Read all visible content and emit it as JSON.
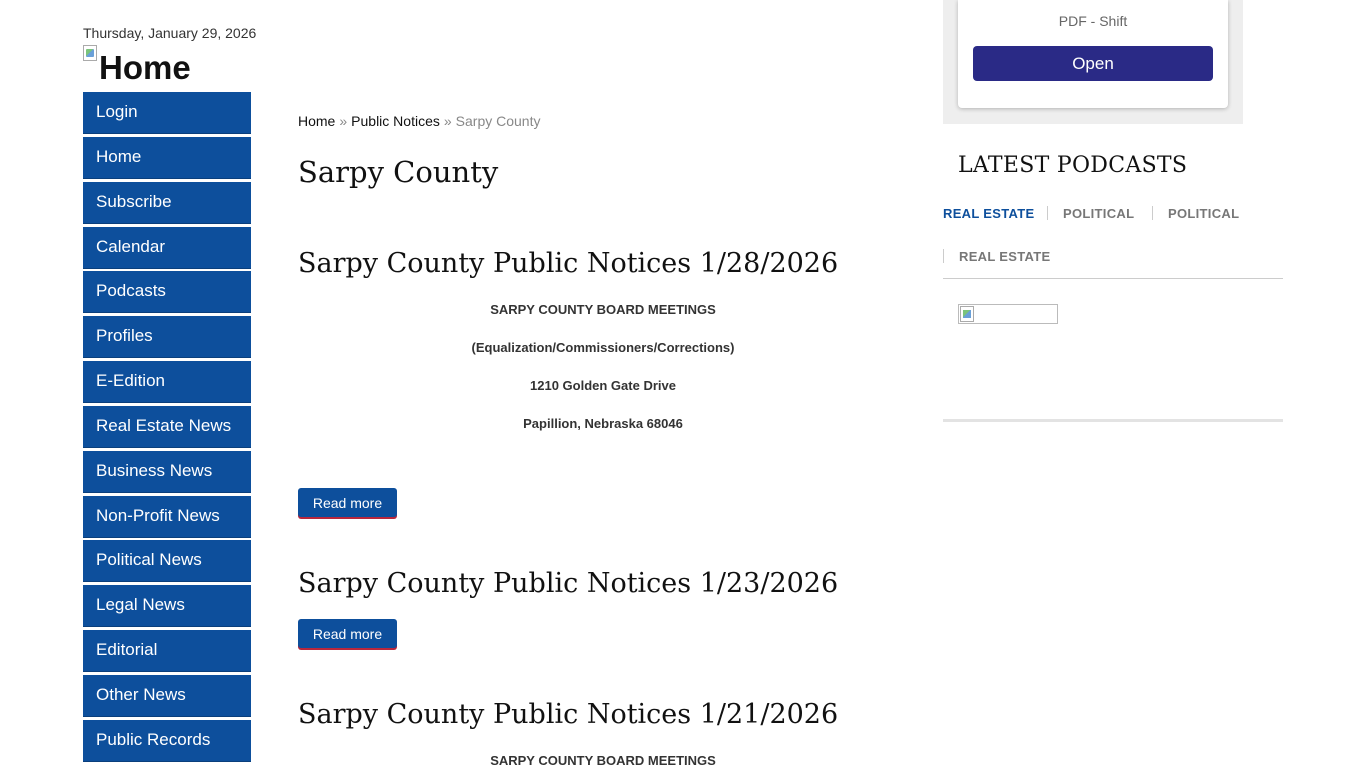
{
  "header": {
    "date": "Thursday, January 29, 2026",
    "logo_alt": "Home"
  },
  "sidebar": {
    "items": [
      {
        "label": "Login"
      },
      {
        "label": "Home"
      },
      {
        "label": "Subscribe"
      },
      {
        "label": "Calendar"
      },
      {
        "label": "Podcasts"
      },
      {
        "label": "Profiles"
      },
      {
        "label": "E-Edition"
      },
      {
        "label": "Real Estate News"
      },
      {
        "label": "Business News"
      },
      {
        "label": "Non-Profit News"
      },
      {
        "label": "Political News"
      },
      {
        "label": "Legal News"
      },
      {
        "label": "Editorial"
      },
      {
        "label": "Other News"
      },
      {
        "label": "Public Records"
      }
    ]
  },
  "breadcrumb": {
    "home": "Home",
    "sep": "»",
    "section": "Public Notices",
    "current": "Sarpy County"
  },
  "main": {
    "page_title": "Sarpy County",
    "read_more_label": "Read more",
    "articles": [
      {
        "title": "Sarpy County Public Notices 1/28/2026",
        "lines": [
          "SARPY COUNTY BOARD MEETINGS",
          "(Equalization/Commissioners/Corrections)",
          "1210 Golden Gate Drive",
          "Papillion, Nebraska 68046"
        ]
      },
      {
        "title": "Sarpy County Public Notices 1/23/2026",
        "lines": []
      },
      {
        "title": "Sarpy County Public Notices 1/21/2026",
        "lines": [
          "SARPY COUNTY BOARD MEETINGS"
        ]
      }
    ]
  },
  "right": {
    "pdf_label": "PDF - Shift",
    "open_label": "Open",
    "latest_heading": "LATEST PODCASTS",
    "tabs": [
      {
        "label": "REAL ESTATE",
        "active": true
      },
      {
        "label": "POLITICAL",
        "active": false
      },
      {
        "label": "POLITICAL",
        "active": false
      },
      {
        "label": "REAL ESTATE",
        "active": false
      }
    ]
  },
  "colors": {
    "nav_blue": "#0d4f9c",
    "open_button": "#2a2a86",
    "active_tab": "#0d4f9c",
    "tab_inactive": "#777777"
  }
}
